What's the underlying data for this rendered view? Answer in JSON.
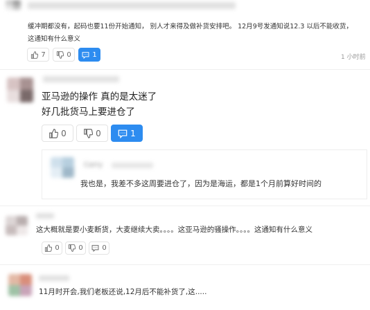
{
  "comment1": {
    "line1": "缓冲期都没有，起码也要11份开始通知，  别人才来得及做补货安排吧。 12月9号发通知说12.3 以后不能收货，",
    "line2": "这通知有什么意义",
    "like_count": "7",
    "dislike_count": "0",
    "reply_count": "1",
    "time": "1 小时前"
  },
  "comment2": {
    "line1": "亚马逊的操作 真的是太迷了",
    "line2": "好几批货马上要进仓了",
    "like_count": "0",
    "dislike_count": "0",
    "reply_count": "1",
    "reply": {
      "username": "Carry",
      "text": "我也是，我差不多这周要进仓了，因为是海运，都是1个月前算好时间的"
    }
  },
  "comment3": {
    "text": "这大概就是要小麦断货，大麦继续大卖。。。。这亚马逊的骚操作。。。。这通知有什么意义",
    "like_count": "0",
    "dislike_count": "0",
    "reply_count": "0"
  },
  "comment4": {
    "text": "11月时开会,我们老板还说,12月后不能补货了,这....."
  },
  "colors": {
    "accent": "#2d8cf0",
    "border": "#e3e3e3",
    "text": "#333333",
    "muted": "#999999"
  },
  "icons": [
    "thumbs-up-icon",
    "thumbs-down-icon",
    "comment-icon"
  ]
}
